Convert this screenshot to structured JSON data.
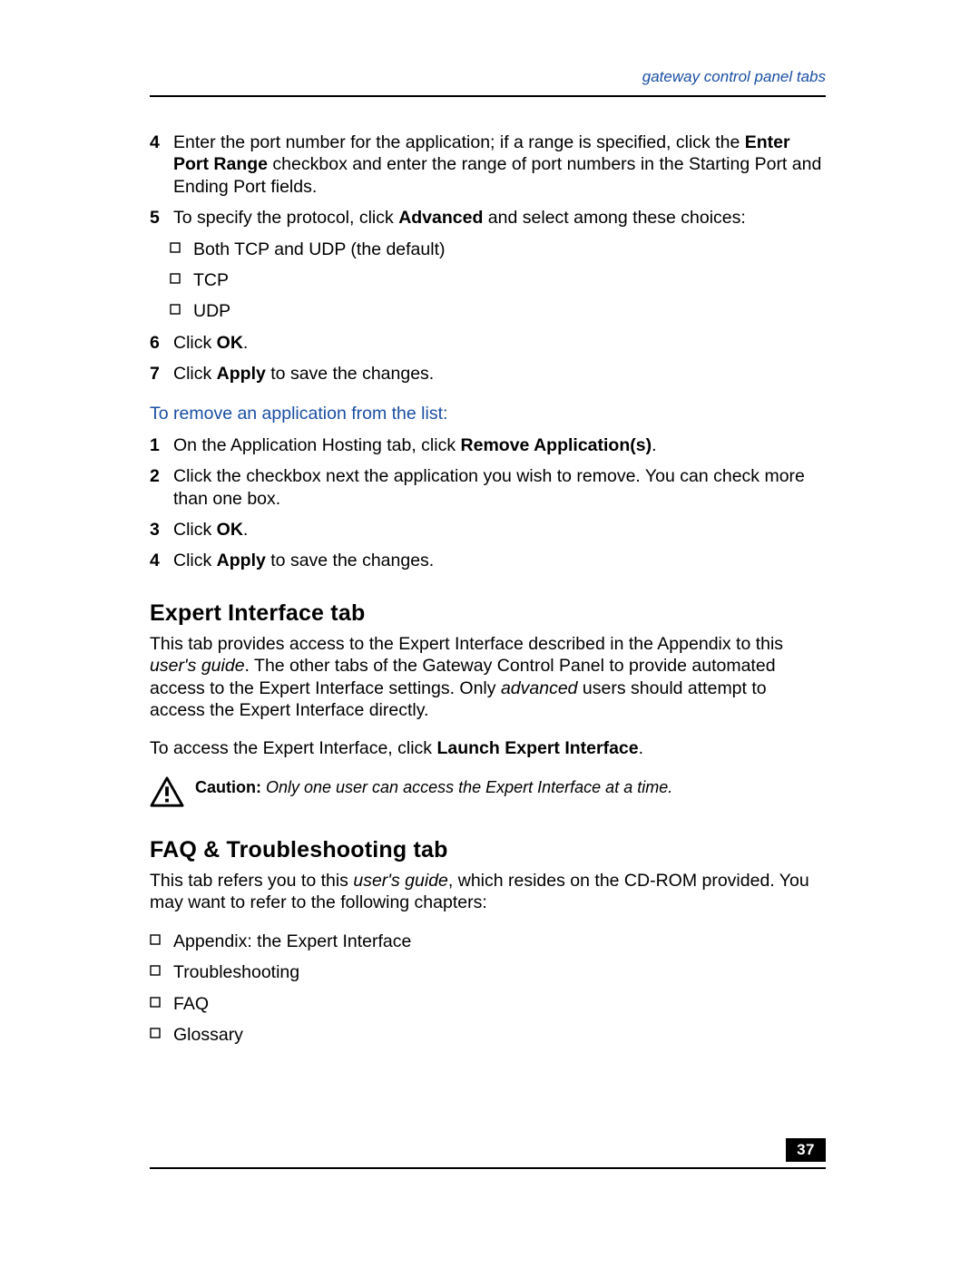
{
  "header": {
    "running_head": "gateway control panel tabs"
  },
  "page_number": "37",
  "steps_top": [
    {
      "num": "4",
      "segments": [
        {
          "t": "Enter the port number for the application; if a range is specified, click the "
        },
        {
          "t": "Enter Port Range",
          "b": true
        },
        {
          "t": " checkbox and enter the range of port numbers in the Starting Port and Ending Port fields."
        }
      ]
    },
    {
      "num": "5",
      "segments": [
        {
          "t": "To specify the protocol, click "
        },
        {
          "t": "Advanced",
          "b": true
        },
        {
          "t": " and select among these choices:"
        }
      ],
      "sub": [
        "Both TCP and UDP (the default)",
        "TCP",
        "UDP"
      ]
    },
    {
      "num": "6",
      "segments": [
        {
          "t": "Click "
        },
        {
          "t": "OK",
          "b": true
        },
        {
          "t": "."
        }
      ]
    },
    {
      "num": "7",
      "segments": [
        {
          "t": "Click "
        },
        {
          "t": "Apply",
          "b": true
        },
        {
          "t": " to save the changes."
        }
      ]
    }
  ],
  "remove_heading": "To remove an application from the list:",
  "steps_remove": [
    {
      "num": "1",
      "segments": [
        {
          "t": "On the Application Hosting tab, click "
        },
        {
          "t": "Remove Application(s)",
          "b": true
        },
        {
          "t": "."
        }
      ]
    },
    {
      "num": "2",
      "segments": [
        {
          "t": "Click the checkbox next the application you wish to remove. You can check more than one box."
        }
      ]
    },
    {
      "num": "3",
      "segments": [
        {
          "t": "Click "
        },
        {
          "t": "OK",
          "b": true
        },
        {
          "t": "."
        }
      ]
    },
    {
      "num": "4",
      "segments": [
        {
          "t": "Click "
        },
        {
          "t": "Apply",
          "b": true
        },
        {
          "t": " to save the changes."
        }
      ]
    }
  ],
  "expert": {
    "heading": "Expert Interface tab",
    "para1": [
      {
        "t": "This tab provides access to the Expert Interface described in the Appendix to this "
      },
      {
        "t": "user's guide",
        "i": true
      },
      {
        "t": ". The other tabs of the Gateway Control Panel to provide automated access to the Expert Interface settings. Only "
      },
      {
        "t": "advanced",
        "i": true
      },
      {
        "t": " users should attempt to access the Expert Interface directly."
      }
    ],
    "para2": [
      {
        "t": "To access the Expert Interface, click "
      },
      {
        "t": "Launch Expert Interface",
        "b": true
      },
      {
        "t": "."
      }
    ],
    "caution_label": "Caution:",
    "caution_text": " Only one user can access the Expert Interface at a time."
  },
  "faq": {
    "heading": "FAQ & Troubleshooting tab",
    "para": [
      {
        "t": "This tab refers you to this "
      },
      {
        "t": "user's guide",
        "i": true
      },
      {
        "t": ", which resides on the CD-ROM provided. You may want to refer to the following chapters:"
      }
    ],
    "items": [
      "Appendix: the Expert Interface",
      "Troubleshooting",
      "FAQ",
      "Glossary"
    ]
  }
}
